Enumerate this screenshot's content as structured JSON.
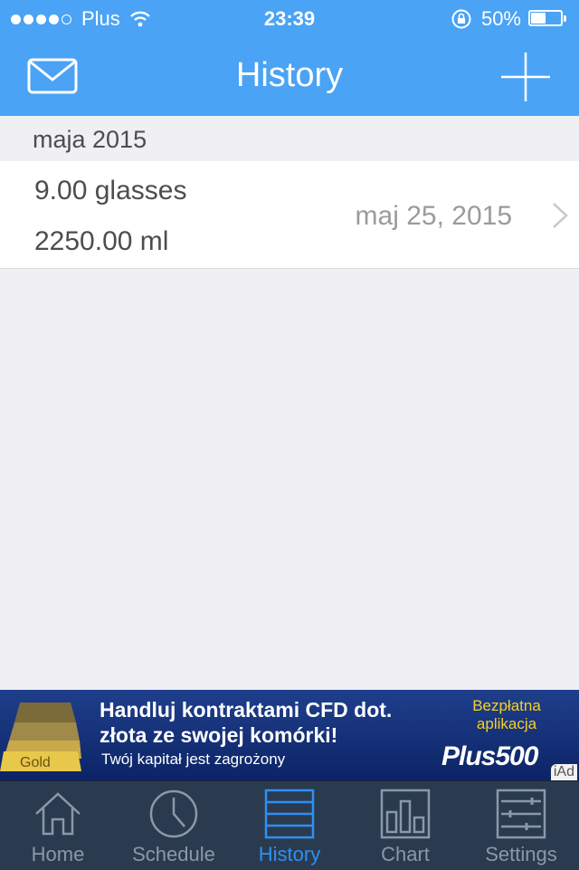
{
  "status_bar": {
    "carrier": "Plus",
    "time": "23:39",
    "battery": "50%",
    "battery_level": 0.5
  },
  "nav": {
    "title": "History",
    "left_icon": "mail-icon",
    "right_icon": "plus-icon"
  },
  "colors": {
    "nav_bg": "#4aa3f5",
    "tab_bg": "#2a3b4f",
    "tab_active": "#2f8ff2",
    "tab_inactive": "#8b98a8"
  },
  "history": {
    "section": "maja 2015",
    "entries": [
      {
        "glasses": "9.00 glasses",
        "ml": "2250.00 ml",
        "date": "maj 25, 2015"
      }
    ]
  },
  "ad": {
    "headline_1": "Handluj kontraktami CFD dot.",
    "headline_2": "złota ze swojej komórki!",
    "subtext": "Twój kapitał jest zagrożony",
    "cta_1": "Bezpłatna",
    "cta_2": "aplikacja",
    "brand": "Plus500",
    "gold_label": "Gold",
    "badge": "iAd"
  },
  "tabs": [
    {
      "label": "Home",
      "icon": "home-icon",
      "active": false
    },
    {
      "label": "Schedule",
      "icon": "clock-icon",
      "active": false
    },
    {
      "label": "History",
      "icon": "list-icon",
      "active": true
    },
    {
      "label": "Chart",
      "icon": "bar-chart-icon",
      "active": false
    },
    {
      "label": "Settings",
      "icon": "sliders-icon",
      "active": false
    }
  ]
}
